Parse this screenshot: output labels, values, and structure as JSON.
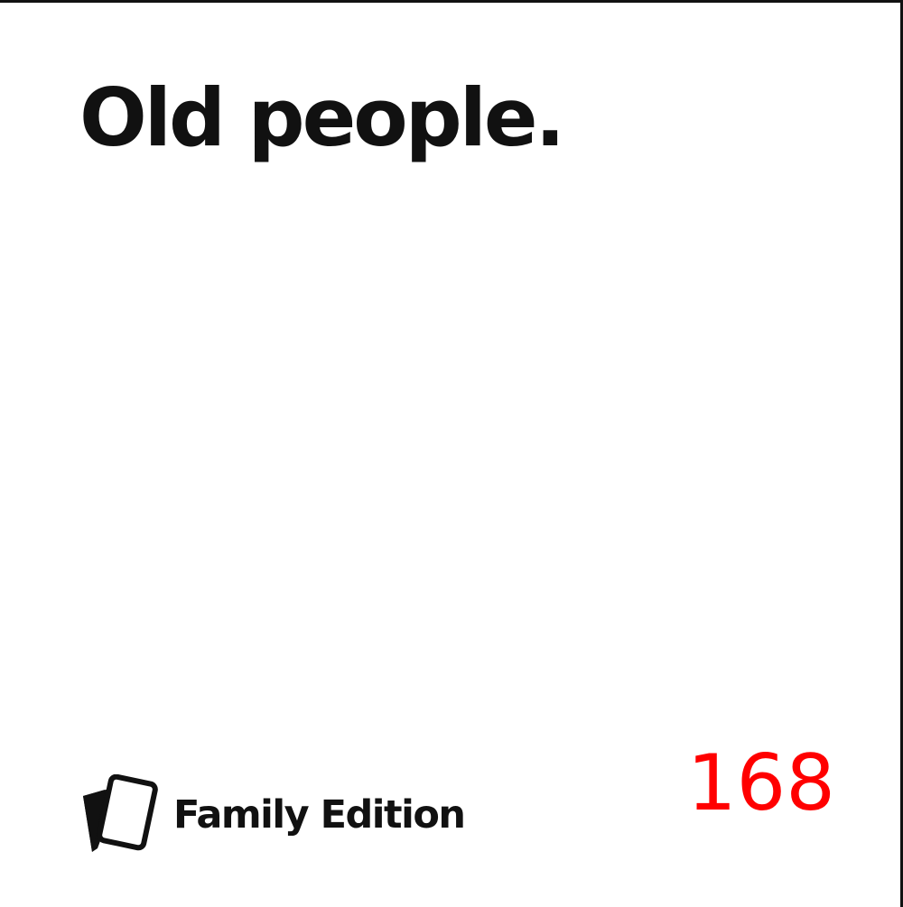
{
  "card": {
    "text": "Old people.",
    "brand_label": "Family Edition",
    "brand_icon": "two-cards-icon",
    "number": "168"
  },
  "colors": {
    "text": "#111111",
    "number": "#ff0000",
    "background": "#ffffff"
  }
}
